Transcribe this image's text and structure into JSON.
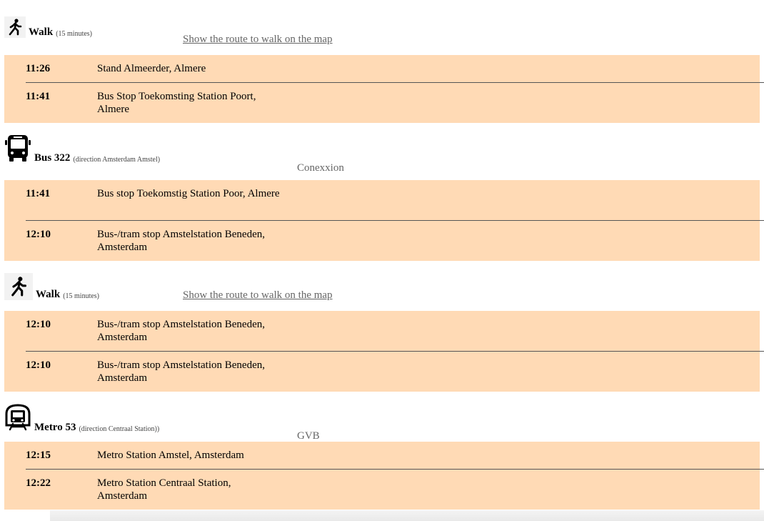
{
  "legs": [
    {
      "icon": "walk-icon",
      "mode": "Walk",
      "sub": "(15 minutes)",
      "link": "Show the route to walk on the map",
      "stops": [
        {
          "time": "11:26",
          "name": "Stand Almeerder, Almere"
        },
        {
          "time": "11:41",
          "name": "Bus Stop Toekomsting Station Poort, Almere"
        }
      ]
    },
    {
      "icon": "bus-icon",
      "mode": "Bus 322",
      "sub": "(direction Amsterdam Amstel)",
      "operator": "Conexxion",
      "stops": [
        {
          "time": "11:41",
          "name": "Bus stop Toekomstig Station Poor, Almere"
        },
        {
          "time": "12:10",
          "name": "Bus-/tram stop Amstelstation Beneden, Amsterdam"
        }
      ]
    },
    {
      "icon": "walk-icon",
      "mode": "Walk",
      "sub": "(15 minutes)",
      "link": "Show the route to walk on the map",
      "stops": [
        {
          "time": "12:10",
          "name": "Bus-/tram stop Amstelstation Beneden, Amsterdam"
        },
        {
          "time": "12:10",
          "name": "Bus-/tram stop Amstelstation Beneden, Amsterdam"
        }
      ]
    },
    {
      "icon": "metro-icon",
      "mode": "Metro 53",
      "sub": "(direction Centraal Station))",
      "operator": "GVB",
      "stops": [
        {
          "time": "12:15",
          "name": "Metro Station Amstel, Amsterdam"
        },
        {
          "time": "12:22",
          "name": "Metro Station Centraal Station, Amsterdam"
        }
      ]
    }
  ]
}
